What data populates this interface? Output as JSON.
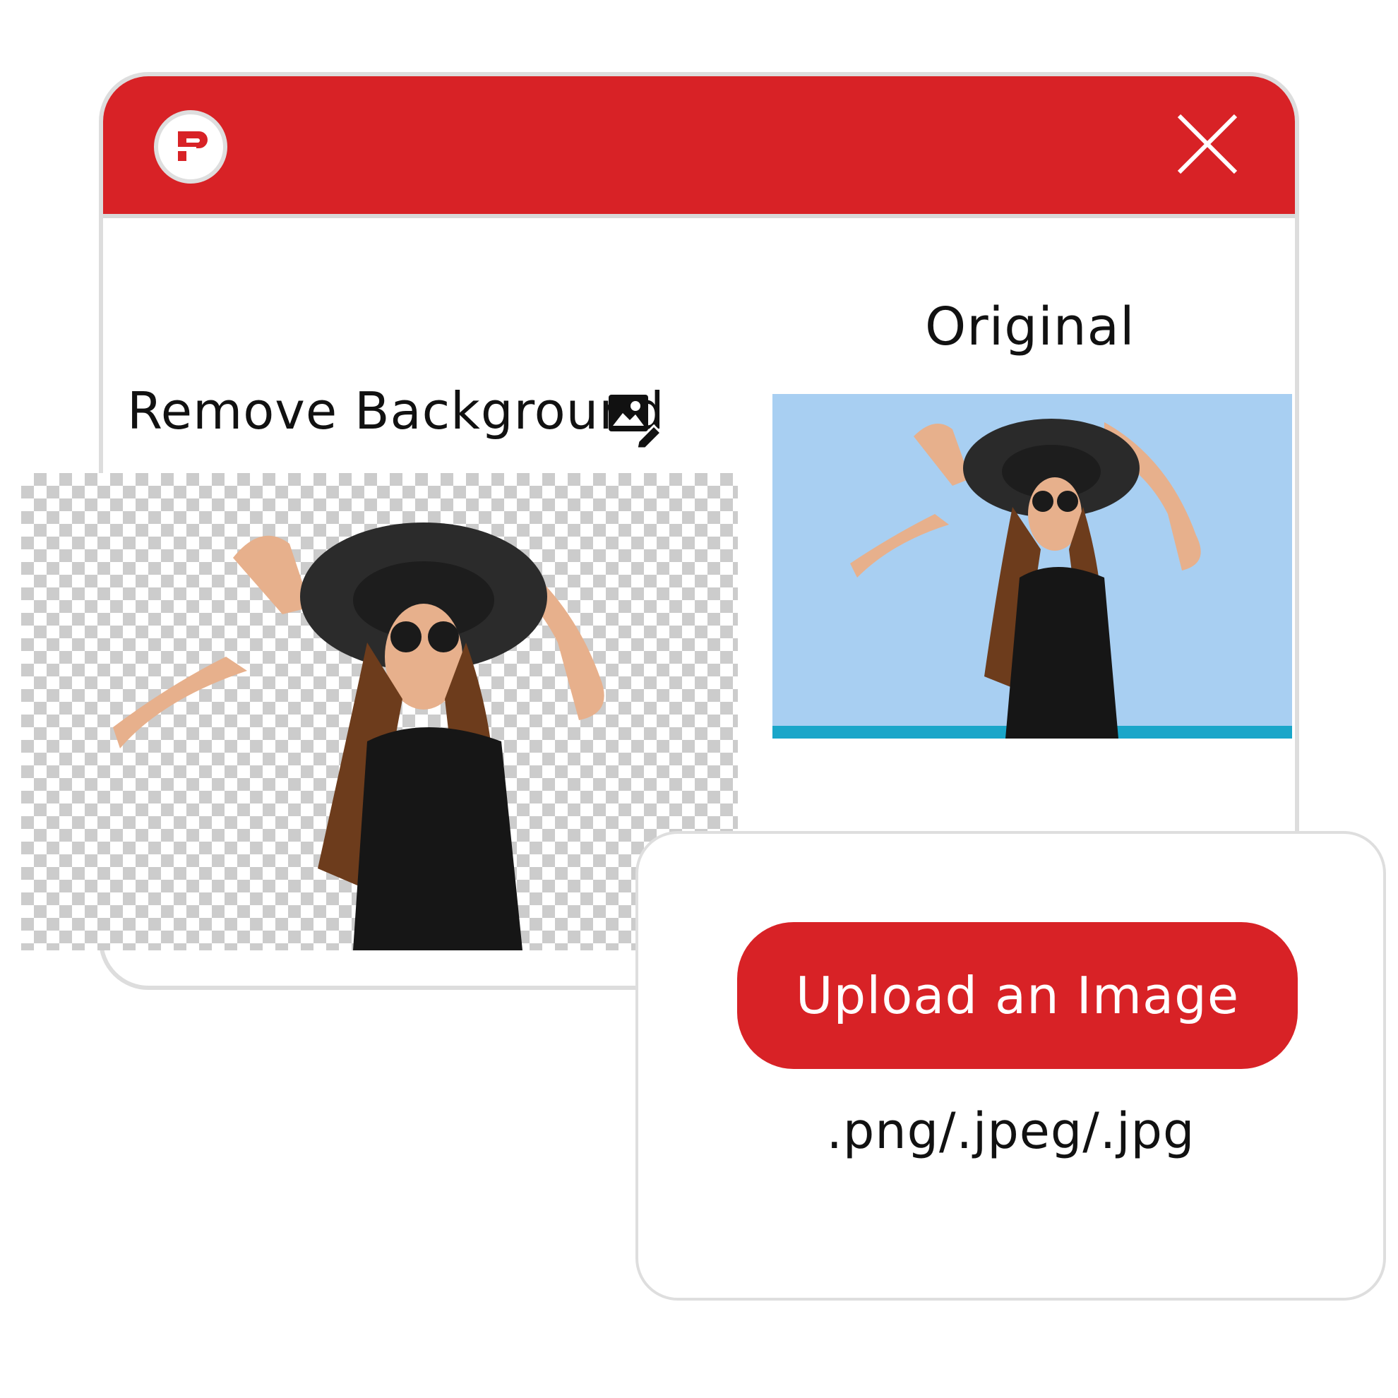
{
  "window": {
    "logo_icon": "brand-logo-icon",
    "close_icon": "close-icon",
    "accent_color": "#d82226"
  },
  "remove_background": {
    "title": "Remove Background",
    "icon": "image-edit-icon"
  },
  "original": {
    "title": "Original"
  },
  "upload": {
    "button_label": "Upload an Image",
    "formats": ".png/.jpeg/.jpg"
  }
}
